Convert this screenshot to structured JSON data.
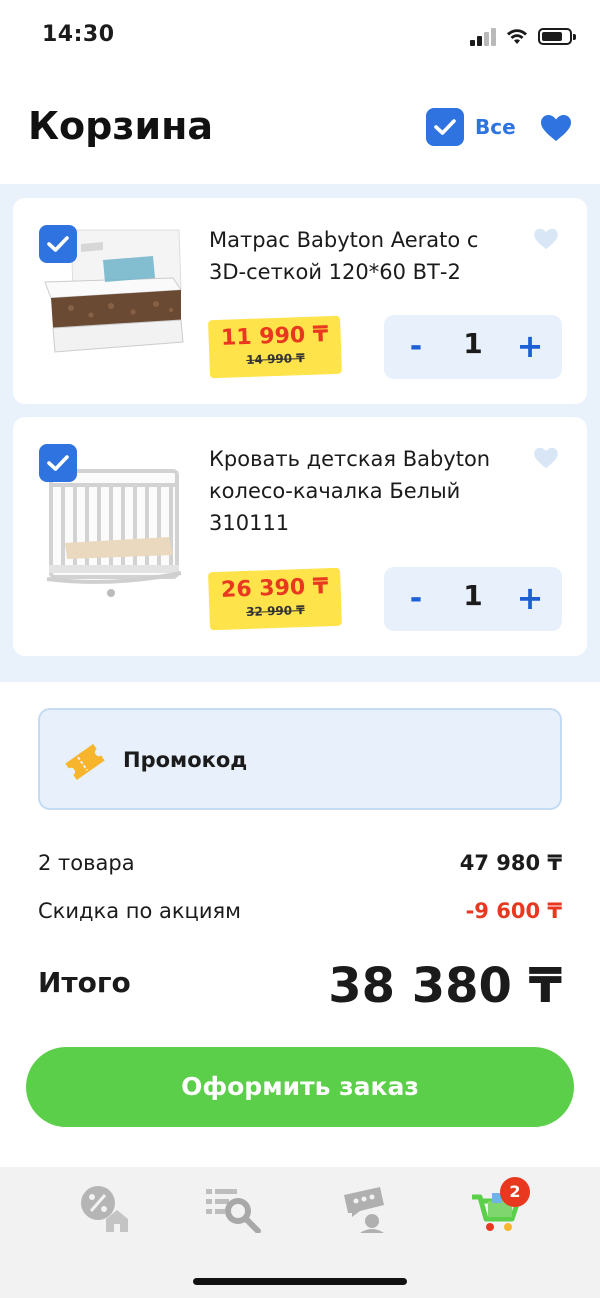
{
  "status_bar": {
    "time": "14:30"
  },
  "header": {
    "title": "Корзина",
    "select_all_label": "Все"
  },
  "cart": {
    "items": [
      {
        "name": "Матрас Babyton Aerato с 3D-сеткой 120*60 ВТ-2",
        "price": "11 990 ₸",
        "old_price": "14 990 ₸",
        "quantity": "1",
        "minus": "-",
        "plus": "+"
      },
      {
        "name": "Кровать детская Babyton колесо-качалка Белый 310111",
        "price": "26 390 ₸",
        "old_price": "32 990 ₸",
        "quantity": "1",
        "minus": "-",
        "plus": "+"
      }
    ]
  },
  "promo": {
    "label": "Промокод"
  },
  "summary": {
    "items_label": "2 товара",
    "items_value": "47 980 ₸",
    "discount_label": "Скидка по акциям",
    "discount_value": "-9 600 ₸",
    "total_label": "Итого",
    "total_value": "38 380 ₸"
  },
  "checkout": {
    "label": "Оформить заказ"
  },
  "tab_bar": {
    "cart_badge": "2"
  },
  "colors": {
    "accent": "#2f73e0",
    "checkout": "#5ccf4a",
    "price_red": "#e8381f",
    "price_tag": "#ffe34a",
    "badge": "#e8381f"
  },
  "icons": [
    "select-all-check-icon",
    "favorites-heart-icon",
    "item-heart-icon",
    "promo-ticket-icon",
    "tab-home-discount-icon",
    "tab-catalog-search-icon",
    "tab-support-icon",
    "tab-cart-icon"
  ]
}
